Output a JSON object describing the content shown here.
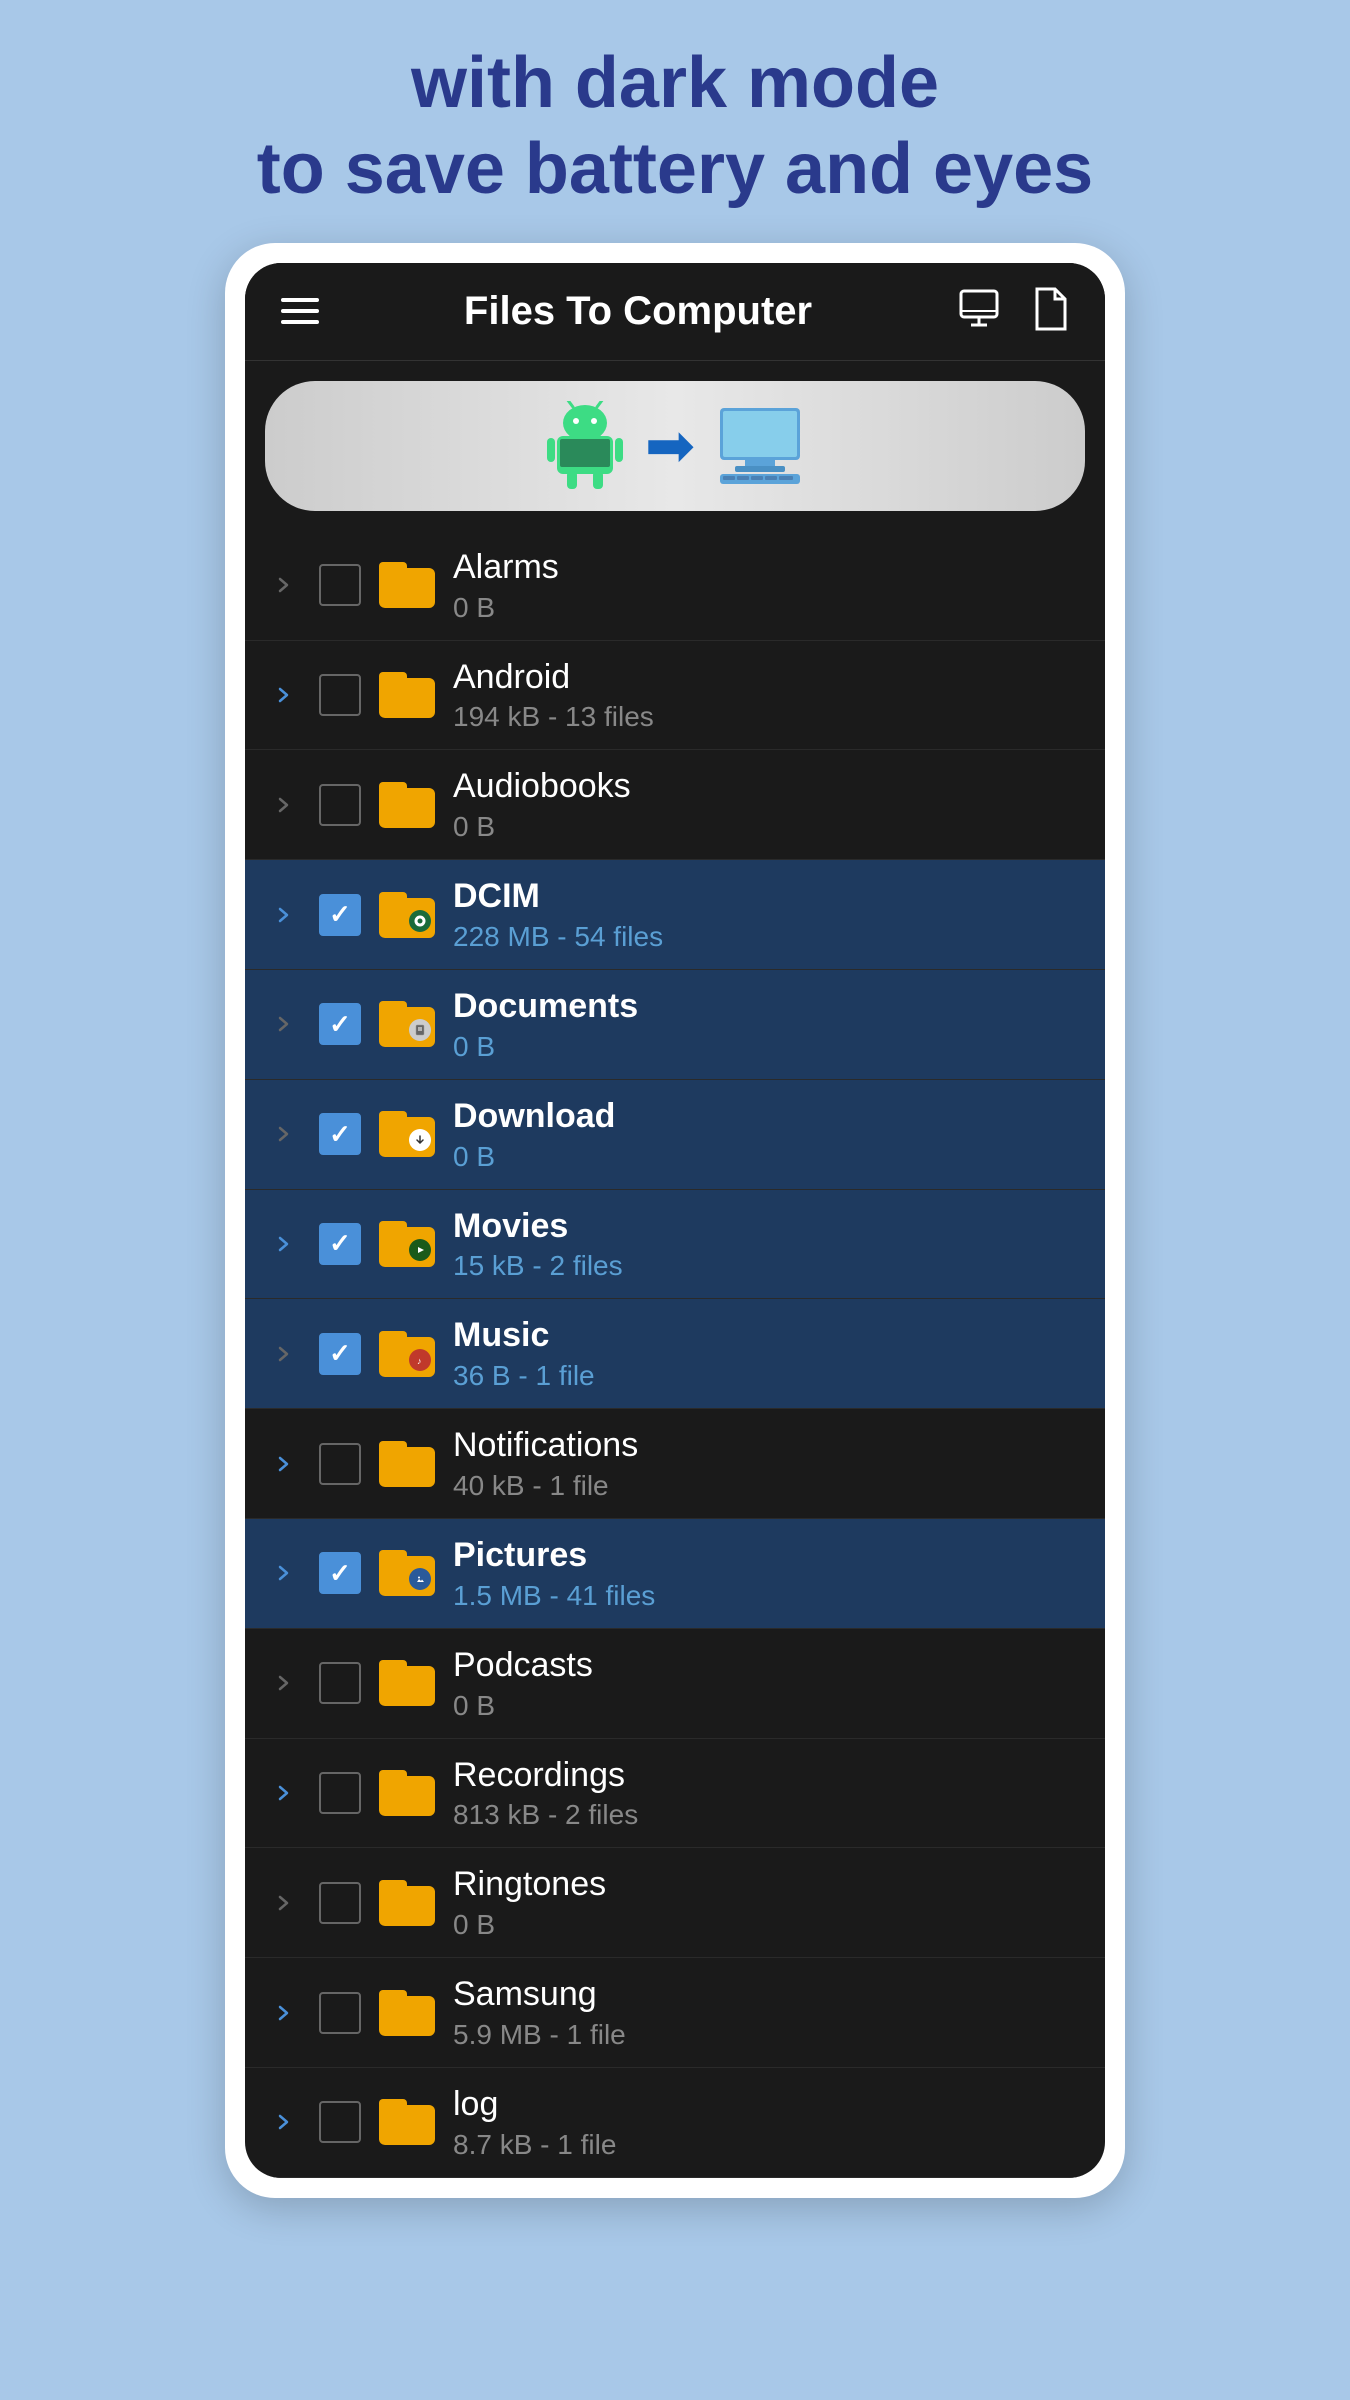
{
  "header": {
    "line1": "with dark mode",
    "line2": "to save battery and eyes"
  },
  "app": {
    "title": "Files To Computer",
    "menu_icon": "hamburger",
    "monitor_icon": "monitor",
    "file_icon": "file"
  },
  "banner": {
    "description": "Android to Computer transfer"
  },
  "folders": [
    {
      "name": "Alarms",
      "size": "0 B",
      "selected": false,
      "chevron_active": false,
      "badge": null
    },
    {
      "name": "Android",
      "size": "194 kB - 13 files",
      "selected": false,
      "chevron_active": true,
      "badge": null
    },
    {
      "name": "Audiobooks",
      "size": "0 B",
      "selected": false,
      "chevron_active": false,
      "badge": null
    },
    {
      "name": "DCIM",
      "size": "228 MB - 54 files",
      "selected": true,
      "chevron_active": true,
      "badge": "camera"
    },
    {
      "name": "Documents",
      "size": "0 B",
      "selected": true,
      "chevron_active": false,
      "badge": "doc"
    },
    {
      "name": "Download",
      "size": "0 B",
      "selected": true,
      "chevron_active": false,
      "badge": "download"
    },
    {
      "name": "Movies",
      "size": "15 kB - 2 files",
      "selected": true,
      "chevron_active": true,
      "badge": "video"
    },
    {
      "name": "Music",
      "size": "36 B - 1 file",
      "selected": true,
      "chevron_active": false,
      "badge": "music"
    },
    {
      "name": "Notifications",
      "size": "40 kB - 1 file",
      "selected": false,
      "chevron_active": true,
      "badge": null
    },
    {
      "name": "Pictures",
      "size": "1.5 MB - 41 files",
      "selected": true,
      "chevron_active": true,
      "badge": "pictures"
    },
    {
      "name": "Podcasts",
      "size": "0 B",
      "selected": false,
      "chevron_active": false,
      "badge": null
    },
    {
      "name": "Recordings",
      "size": "813 kB - 2 files",
      "selected": false,
      "chevron_active": true,
      "badge": null
    },
    {
      "name": "Ringtones",
      "size": "0 B",
      "selected": false,
      "chevron_active": false,
      "badge": null
    },
    {
      "name": "Samsung",
      "size": "5.9 MB - 1 file",
      "selected": false,
      "chevron_active": true,
      "badge": null
    },
    {
      "name": "log",
      "size": "8.7 kB - 1 file",
      "selected": false,
      "chevron_active": true,
      "badge": null
    }
  ]
}
